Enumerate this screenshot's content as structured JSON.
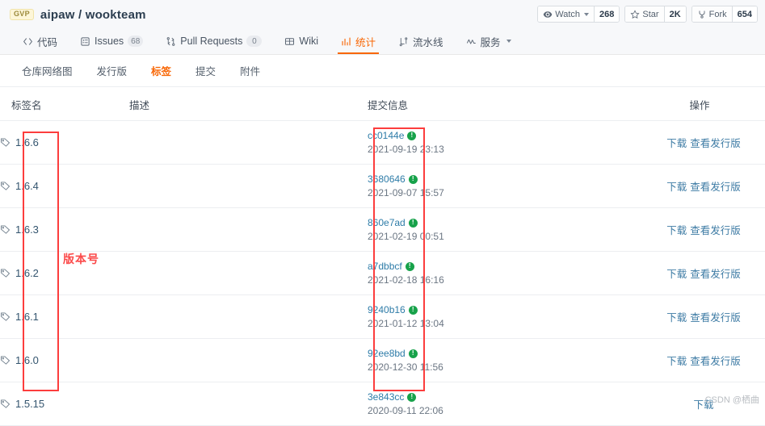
{
  "header": {
    "badge": "GVP",
    "owner": "aipaw",
    "separator": "/",
    "repo": "wookteam",
    "full_title": "aipaw / wookteam",
    "actions": [
      {
        "icon": "eye-icon",
        "label": "Watch",
        "count": "268",
        "has_caret": true
      },
      {
        "icon": "star-icon",
        "label": "Star",
        "count": "2K",
        "has_caret": false
      },
      {
        "icon": "fork-icon",
        "label": "Fork",
        "count": "654",
        "has_caret": false
      }
    ]
  },
  "main_nav": [
    {
      "icon": "code-icon",
      "label": "代码",
      "badge": null,
      "active": false
    },
    {
      "icon": "issues-icon",
      "label": "Issues",
      "badge": "68",
      "active": false
    },
    {
      "icon": "pull-request-icon",
      "label": "Pull Requests",
      "badge": "0",
      "active": false
    },
    {
      "icon": "wiki-icon",
      "label": "Wiki",
      "badge": null,
      "active": false
    },
    {
      "icon": "stats-icon",
      "label": "统计",
      "badge": null,
      "active": true
    },
    {
      "icon": "pipeline-icon",
      "label": "流水线",
      "badge": null,
      "active": false
    },
    {
      "icon": "service-icon",
      "label": "服务",
      "badge": null,
      "active": false,
      "has_caret": true
    }
  ],
  "sub_nav": [
    {
      "label": "仓库网络图",
      "active": false
    },
    {
      "label": "发行版",
      "active": false
    },
    {
      "label": "标签",
      "active": true
    },
    {
      "label": "提交",
      "active": false
    },
    {
      "label": "附件",
      "active": false
    }
  ],
  "table": {
    "columns": [
      "标签名",
      "描述",
      "提交信息",
      "操作"
    ],
    "rows": [
      {
        "tag": "1.6.6",
        "desc": "",
        "sha": "cc0144e",
        "date": "2021-09-19 23:13",
        "ops": [
          "下载",
          "查看发行版"
        ]
      },
      {
        "tag": "1.6.4",
        "desc": "",
        "sha": "3680646",
        "date": "2021-09-07 15:57",
        "ops": [
          "下载",
          "查看发行版"
        ]
      },
      {
        "tag": "1.6.3",
        "desc": "",
        "sha": "860e7ad",
        "date": "2021-02-19 00:51",
        "ops": [
          "下载",
          "查看发行版"
        ]
      },
      {
        "tag": "1.6.2",
        "desc": "",
        "sha": "a7dbbcf",
        "date": "2021-02-18 16:16",
        "ops": [
          "下载",
          "查看发行版"
        ]
      },
      {
        "tag": "1.6.1",
        "desc": "",
        "sha": "9240b16",
        "date": "2021-01-12 13:04",
        "ops": [
          "下载",
          "查看发行版"
        ]
      },
      {
        "tag": "1.6.0",
        "desc": "",
        "sha": "92ee8bd",
        "date": "2020-12-30 11:56",
        "ops": [
          "下载",
          "查看发行版"
        ]
      },
      {
        "tag": "1.5.15",
        "desc": "",
        "sha": "3e843cc",
        "date": "2020-09-11 22:06",
        "ops": [
          "下载"
        ]
      }
    ]
  },
  "annotations": {
    "version_label": "版本号",
    "box_color": "#fc3d3d"
  },
  "watermark": "CSDN @栖曲",
  "colors": {
    "accent": "#f86706",
    "link": "#3f7ca5",
    "commit_link": "#2e7ca8",
    "header_bg": "#f7f8fa",
    "signed_green": "#17a24a",
    "annotation_red": "#fc3d3d"
  }
}
